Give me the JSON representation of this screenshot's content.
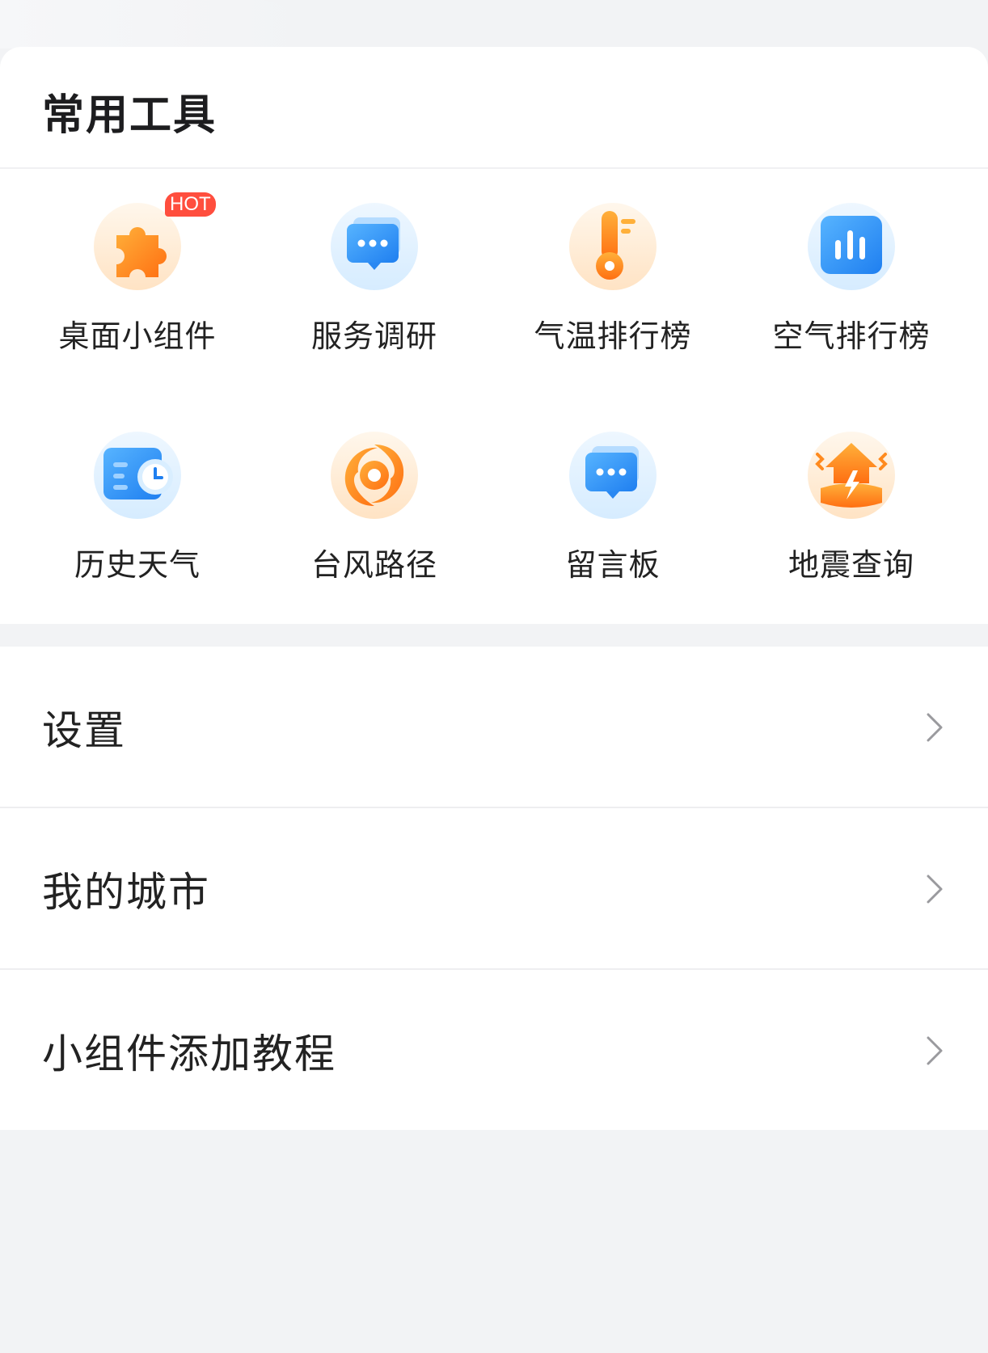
{
  "tools_section": {
    "title": "常用工具",
    "hot_badge": "HOT",
    "tools": [
      {
        "label": "桌面小组件",
        "icon": "puzzle-icon"
      },
      {
        "label": "服务调研",
        "icon": "chat-bubble-icon"
      },
      {
        "label": "气温排行榜",
        "icon": "thermometer-icon"
      },
      {
        "label": "空气排行榜",
        "icon": "bar-chart-icon"
      },
      {
        "label": "历史天气",
        "icon": "calendar-clock-icon"
      },
      {
        "label": "台风路径",
        "icon": "typhoon-icon"
      },
      {
        "label": "留言板",
        "icon": "message-board-icon"
      },
      {
        "label": "地震查询",
        "icon": "earthquake-icon"
      }
    ]
  },
  "menu": {
    "items": [
      {
        "label": "设置"
      },
      {
        "label": "我的城市"
      },
      {
        "label": "小组件添加教程"
      }
    ]
  },
  "colors": {
    "accent_orange": "#ff8a1e",
    "accent_blue": "#2f8cf5",
    "hot_red": "#ff4e3e"
  }
}
